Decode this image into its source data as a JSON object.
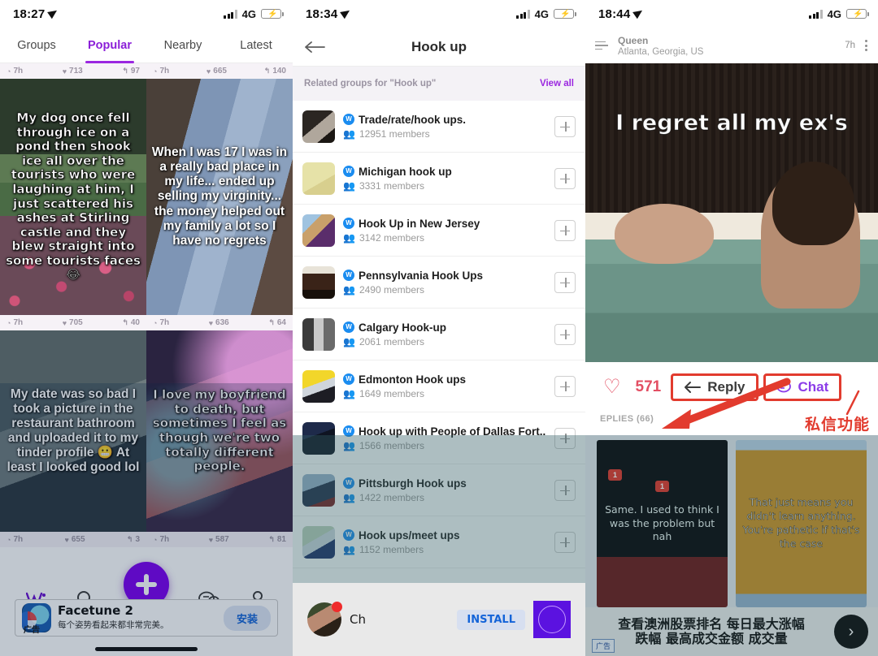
{
  "panel1": {
    "status": {
      "time": "18:27",
      "network": "4G"
    },
    "tabs": [
      {
        "label": "Groups",
        "active": false
      },
      {
        "label": "Popular",
        "active": true
      },
      {
        "label": "Nearby",
        "active": false
      },
      {
        "label": "Latest",
        "active": false
      }
    ],
    "cards": [
      {
        "top": {
          "age": "7h",
          "hearts": "713",
          "replies": "97"
        },
        "text": "My dog once fell through ice on a pond then shook ice all over the tourists who were laughing at him, I just scattered his ashes at Stirling castle and they blew straight into some tourists faces 😂",
        "bottom": {
          "age": "7h",
          "hearts": "705",
          "replies": "40"
        }
      },
      {
        "top": {
          "age": "7h",
          "hearts": "665",
          "replies": "140"
        },
        "text": "When I was 17 I was in a really bad place in my life... ended up selling my virginity... the money helped out my family a lot so I have no regrets",
        "bottom": {
          "age": "7h",
          "hearts": "636",
          "replies": "64"
        }
      },
      {
        "text": "My date was so bad I took a picture in the restaurant bathroom and uploaded it to my tinder profile 😬 At least I looked good lol",
        "bottom": {
          "age": "7h",
          "hearts": "655",
          "replies": "3"
        }
      },
      {
        "text": "I love my boyfriend to death, but sometimes I feel as though we're two totally different people.",
        "bottom": {
          "age": "7h",
          "hearts": "587",
          "replies": "81"
        }
      }
    ],
    "nav": [
      {
        "icon": "whisper-logo"
      },
      {
        "icon": "search-icon"
      },
      {
        "icon": "compose-icon"
      },
      {
        "icon": "messages-icon"
      },
      {
        "icon": "profile-icon"
      }
    ],
    "ad": {
      "badge": "广告",
      "title": "Facetune 2",
      "subtitle": "每个姿势看起来都非常完美。",
      "button": "安装"
    }
  },
  "panel2": {
    "status": {
      "time": "18:34",
      "network": "4G"
    },
    "title": "Hook up",
    "section": {
      "label": "Related groups for \"Hook up\"",
      "view_all": "View all"
    },
    "groups": [
      {
        "name": "Trade/rate/hook ups.",
        "members": "12951 members"
      },
      {
        "name": "Michigan hook up",
        "members": "3331 members"
      },
      {
        "name": "Hook Up in New Jersey",
        "members": "3142 members"
      },
      {
        "name": "Pennsylvania Hook Ups",
        "members": "2490 members"
      },
      {
        "name": "Calgary Hook-up",
        "members": "2061 members"
      },
      {
        "name": "Edmonton Hook ups",
        "members": "1649 members"
      },
      {
        "name": "Hook up with People of Dallas Fort...",
        "members": "1566 members"
      },
      {
        "name": "Pittsburgh Hook ups",
        "members": "1422 members"
      },
      {
        "name": "Hook ups/meet ups",
        "members": "1152 members"
      }
    ],
    "ad": {
      "name": "Ch",
      "button": "INSTALL"
    }
  },
  "panel3": {
    "status": {
      "time": "18:44",
      "network": "4G"
    },
    "post": {
      "author": "Queen",
      "location": "Atlanta, Georgia, US",
      "time": "7h",
      "text": "I regret all my ex's"
    },
    "actions": {
      "likes": "571",
      "reply_label": "Reply",
      "chat_label": "Chat",
      "annotation": "私信功能"
    },
    "replies_header": "EPLIES (66)",
    "replies": [
      {
        "text": "Same. I used to think I was the problem but nah",
        "badges": [
          "1",
          "1"
        ]
      },
      {
        "text": "That just means you didn't learn anything.\n\nYou're pathetic if that's the case"
      }
    ],
    "ad": {
      "line1": "查看澳洲股票排名 每日最大涨幅",
      "line2": "跌幅 最高成交金额 成交量",
      "tag": "广告",
      "next": "›"
    }
  },
  "colors": {
    "accent_purple": "#9b27e0",
    "fab_purple": "#7d00f0",
    "like_red": "#e34f63",
    "annotation_red": "#e23b2e",
    "badge_blue": "#1a8cf0"
  }
}
